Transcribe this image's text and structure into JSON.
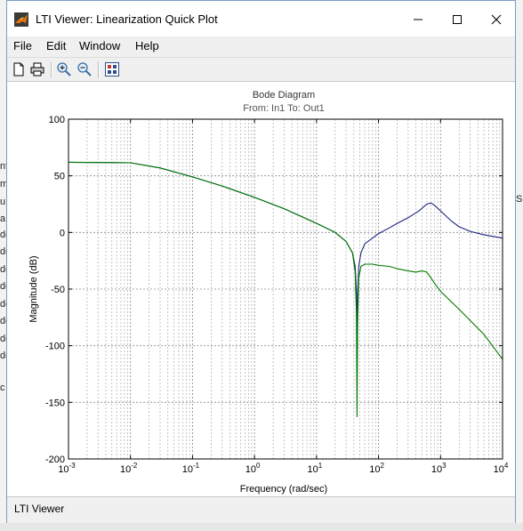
{
  "window": {
    "title": "LTI Viewer: Linearization Quick Plot",
    "controls": {
      "minimize": "—",
      "maximize": "☐",
      "close": "✕"
    }
  },
  "menu": {
    "items": [
      "File",
      "Edit",
      "Window",
      "Help"
    ]
  },
  "toolbar": {
    "icons": [
      "new-file-icon",
      "print-icon",
      "zoom-in-icon",
      "zoom-out-icon",
      "plot-config-icon"
    ]
  },
  "background": {
    "left_fragments": [
      "nt",
      "m",
      "u",
      "a",
      "de",
      "de",
      "de",
      "de",
      "de",
      "de",
      "de",
      "de",
      "c"
    ],
    "right_fragments": [
      "S"
    ]
  },
  "status": {
    "text": "LTI Viewer"
  },
  "chart_data": {
    "type": "line",
    "title": "Bode Diagram",
    "subtitle": "From: In1  To: Out1",
    "xlabel": "Frequency  (rad/sec)",
    "ylabel": "Magnitude (dB)",
    "xscale": "log",
    "xlim": [
      0.001,
      10000
    ],
    "ylim": [
      -200,
      100
    ],
    "yticks": [
      100,
      50,
      0,
      -50,
      -100,
      -150,
      -200
    ],
    "xticks": [
      {
        "base": "10",
        "exp": "-3"
      },
      {
        "base": "10",
        "exp": "-2"
      },
      {
        "base": "10",
        "exp": "-1"
      },
      {
        "base": "10",
        "exp": "0"
      },
      {
        "base": "10",
        "exp": "1"
      },
      {
        "base": "10",
        "exp": "2"
      },
      {
        "base": "10",
        "exp": "3"
      },
      {
        "base": "10",
        "exp": "4"
      }
    ],
    "grid": true,
    "series": [
      {
        "color": "#1a237e",
        "x": [
          0.001,
          0.01,
          0.03,
          0.1,
          0.3,
          1,
          3,
          10,
          20,
          30,
          38,
          42,
          44,
          45,
          46,
          48,
          52,
          60,
          80,
          100,
          150,
          200,
          300,
          450,
          600,
          700,
          800,
          1000,
          1500,
          2000,
          3000,
          5000,
          10000
        ],
        "y": [
          62,
          61.5,
          57,
          49,
          41,
          31,
          21,
          8,
          0,
          -8,
          -18,
          -30,
          -50,
          -90,
          -55,
          -30,
          -18,
          -10,
          -5,
          -1,
          4,
          8,
          13,
          19,
          25,
          26,
          24,
          19,
          10,
          5,
          1,
          -2,
          -5
        ]
      },
      {
        "color": "#007a00",
        "x": [
          0.001,
          0.01,
          0.03,
          0.1,
          0.3,
          1,
          3,
          10,
          20,
          30,
          38,
          42,
          44,
          45,
          46,
          48,
          52,
          60,
          80,
          100,
          150,
          200,
          300,
          400,
          500,
          600,
          700,
          800,
          1000,
          2000,
          5000,
          10000
        ],
        "y": [
          62,
          61.5,
          57,
          49,
          41,
          31,
          21,
          8,
          0,
          -8,
          -18,
          -35,
          -70,
          -163,
          -80,
          -40,
          -30,
          -28,
          -28,
          -29,
          -30,
          -32,
          -34,
          -35,
          -34,
          -35,
          -40,
          -45,
          -52,
          -68,
          -90,
          -112
        ]
      }
    ]
  }
}
